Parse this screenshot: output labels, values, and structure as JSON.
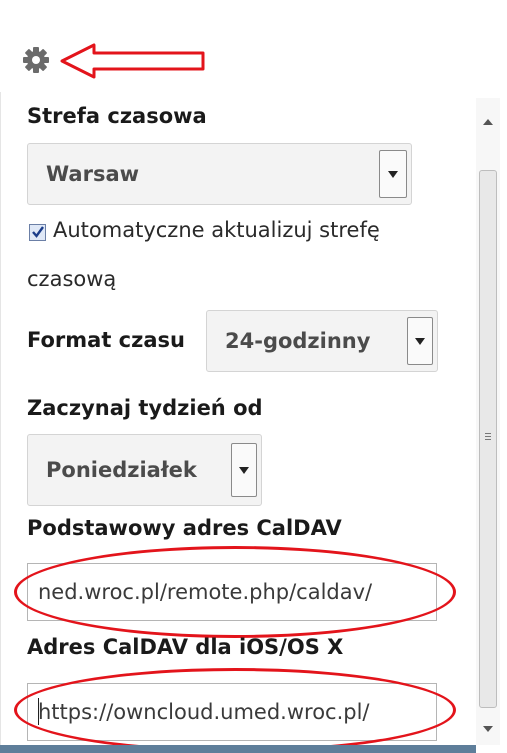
{
  "settings": {
    "timezone_label": "Strefa czasowa",
    "timezone_value": "Warsaw",
    "auto_update_label": "Automatyczne aktualizuj strefę",
    "auto_update_label_cont": "czasową",
    "auto_update_checked": true,
    "time_format_label": "Format czasu",
    "time_format_value": "24-godzinny",
    "week_start_label": "Zaczynaj tydzień od",
    "week_start_value": "Poniedziałek",
    "caldav_primary_label": "Podstawowy adres CalDAV",
    "caldav_primary_value": "ned.wroc.pl/remote.php/caldav/",
    "caldav_ios_label": "Adres CalDAV dla iOS/OS X",
    "caldav_ios_value": "https://owncloud.umed.wroc.pl/"
  },
  "icons": {
    "gear": "gear-icon",
    "arrow": "arrow-left-icon"
  },
  "colors": {
    "annotation_red": "#e3141b",
    "bottom_bar": "#5e7e9a"
  }
}
